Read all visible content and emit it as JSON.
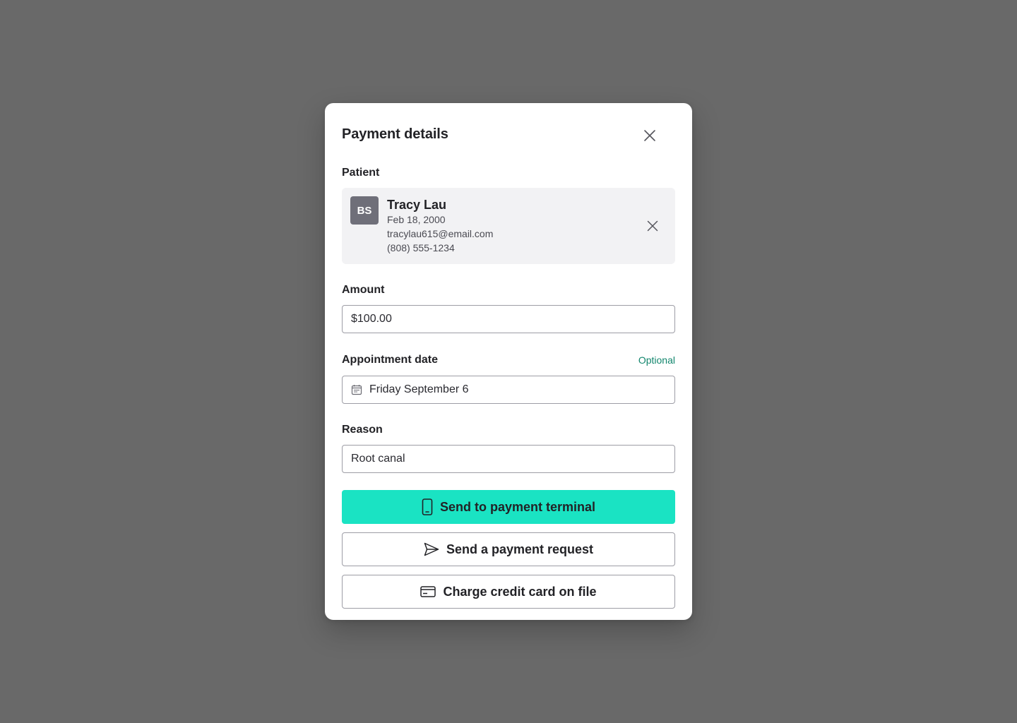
{
  "modal": {
    "title": "Payment details"
  },
  "patient": {
    "label": "Patient",
    "initials": "BS",
    "name": "Tracy Lau",
    "dob": "Feb 18, 2000",
    "email": "tracylau615@email.com",
    "phone": "(808) 555-1234"
  },
  "amount": {
    "label": "Amount",
    "value": "$100.00"
  },
  "appointment_date": {
    "label": "Appointment date",
    "optional_label": "Optional",
    "value": "Friday September 6"
  },
  "reason": {
    "label": "Reason",
    "value": "Root canal"
  },
  "actions": {
    "send_terminal": "Send to payment terminal",
    "send_request": "Send a payment request",
    "charge_card": "Charge credit card on file"
  },
  "colors": {
    "backdrop": "#696969",
    "primary_button": "#1ae3c3",
    "optional_text": "#12866d",
    "avatar_bg": "#6f6f79",
    "patient_card_bg": "#f2f2f4"
  },
  "icons": {
    "close": "close-icon",
    "remove_patient": "close-icon",
    "calendar": "calendar-icon",
    "terminal": "mobile-phone-icon",
    "request": "paper-plane-icon",
    "card": "credit-card-icon"
  }
}
